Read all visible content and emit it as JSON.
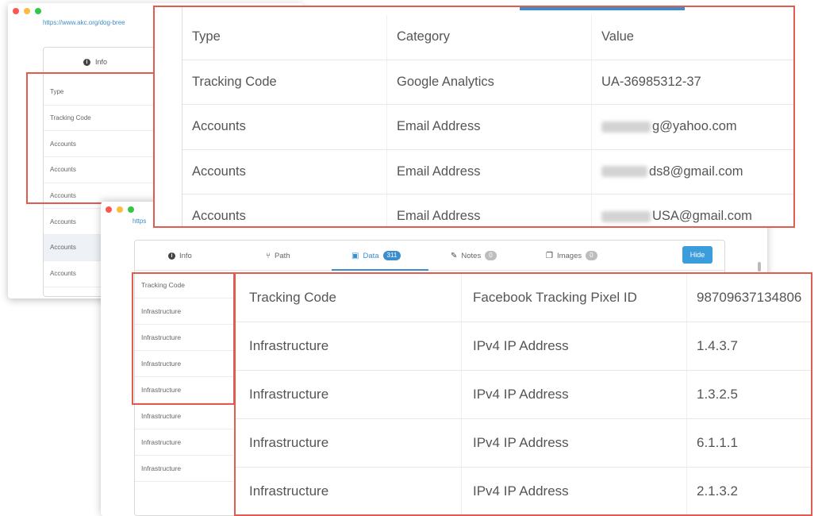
{
  "back_window": {
    "url": "https://www.akc.org/dog-bree",
    "tab_info": "Info",
    "rows": [
      "Type",
      "Tracking Code",
      "Accounts",
      "Accounts",
      "Accounts",
      "Accounts",
      "Accounts",
      "Accounts"
    ]
  },
  "front_window": {
    "url": "https",
    "tabs": [
      {
        "label": "Info",
        "icon": "info-icon"
      },
      {
        "label": "Path",
        "icon": "path-icon"
      },
      {
        "label": "Data",
        "icon": "data-icon",
        "badge": "311",
        "active": true
      },
      {
        "label": "Notes",
        "icon": "notes-icon",
        "badge": "0"
      },
      {
        "label": "Images",
        "icon": "images-icon",
        "badge": "0"
      }
    ],
    "hide_label": "Hide",
    "rows": [
      "Tracking Code",
      "Infrastructure",
      "Infrastructure",
      "Infrastructure",
      "Infrastructure",
      "Infrastructure",
      "Infrastructure",
      "Infrastructure"
    ]
  },
  "zoom_top": {
    "headers": [
      "Type",
      "Category",
      "Value"
    ],
    "rows": [
      {
        "type": "Tracking Code",
        "category": "Google Analytics",
        "value": "UA-36985312-37"
      },
      {
        "type": "Accounts",
        "category": "Email Address",
        "value": "g@yahoo.com"
      },
      {
        "type": "Accounts",
        "category": "Email Address",
        "value": "ds8@gmail.com"
      },
      {
        "type": "Accounts",
        "category": "Email Address",
        "value": "USA@gmail.com"
      }
    ]
  },
  "zoom_bottom": {
    "rows": [
      {
        "type": "Tracking Code",
        "category": "Facebook Tracking Pixel ID",
        "value": "98709637134806"
      },
      {
        "type": "Infrastructure",
        "category": "IPv4 IP Address",
        "value": "1.4.3.7"
      },
      {
        "type": "Infrastructure",
        "category": "IPv4 IP Address",
        "value": "1.3.2.5"
      },
      {
        "type": "Infrastructure",
        "category": "IPv4 IP Address",
        "value": "6.1.1.1"
      },
      {
        "type": "Infrastructure",
        "category": "IPv4 IP Address",
        "value": "2.1.3.2"
      }
    ]
  },
  "colors": {
    "highlight": "#e25b50",
    "accent": "#3c8dcb"
  }
}
